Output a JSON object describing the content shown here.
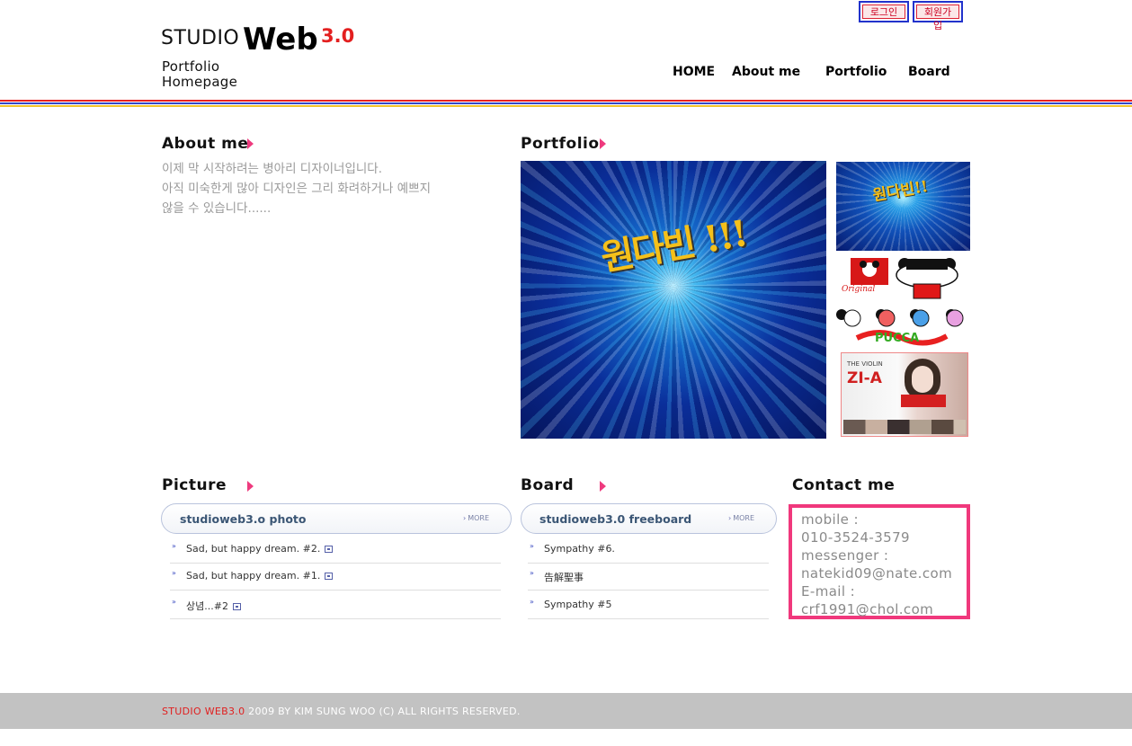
{
  "auth": {
    "login": "로그인",
    "signup": "회원가입"
  },
  "logo": {
    "studio": "STUDIO",
    "web": "Web",
    "version": "3.0",
    "subtitle_line1": "Portfolio",
    "subtitle_line2": "Homepage"
  },
  "nav": {
    "home": "HOME",
    "about": "About me",
    "portfolio": "Portfolio",
    "board": "Board"
  },
  "colors": {
    "stripe_top": "#e82020",
    "stripe_mid": "#3347c8",
    "stripe_bottom": "#f3c32a",
    "accent": "#f0387c"
  },
  "about": {
    "title": "About me",
    "line1": "이제 막 시작하려는 병아리 디자이너입니다.",
    "line2": "아직 미숙한게 많아 디자인은 그리 화려하거나 예쁘지",
    "line3": "않을 수 있습니다......"
  },
  "portfolio": {
    "title": "Portfolio",
    "thumb3_caption": "THE VIOLIN",
    "thumb3_title": "ZI-A"
  },
  "picture": {
    "title": "Picture",
    "board_title": "studioweb3.o photo",
    "more": "MORE",
    "items": [
      "Sad, but happy dream. #2.",
      "Sad, but happy dream. #1.",
      "상념...#2"
    ]
  },
  "board": {
    "title": "Board",
    "board_title": "studioweb3.0 freeboard",
    "more": "MORE",
    "items": [
      "Sympathy #6.",
      "告解聖事",
      "Sympathy #5"
    ]
  },
  "contact": {
    "title": "Contact me",
    "mobile_label": "mobile :",
    "mobile": "010-3524-3579",
    "messenger_label": "messenger :",
    "messenger": "natekid09@nate.com",
    "email_label": "E-mail :",
    "email": "crf1991@chol.com"
  },
  "footer": {
    "brand": "STUDIO WEB3.0",
    "text": " 2009 BY KIM SUNG WOO  (C) ALL RIGHTS RESERVED."
  }
}
